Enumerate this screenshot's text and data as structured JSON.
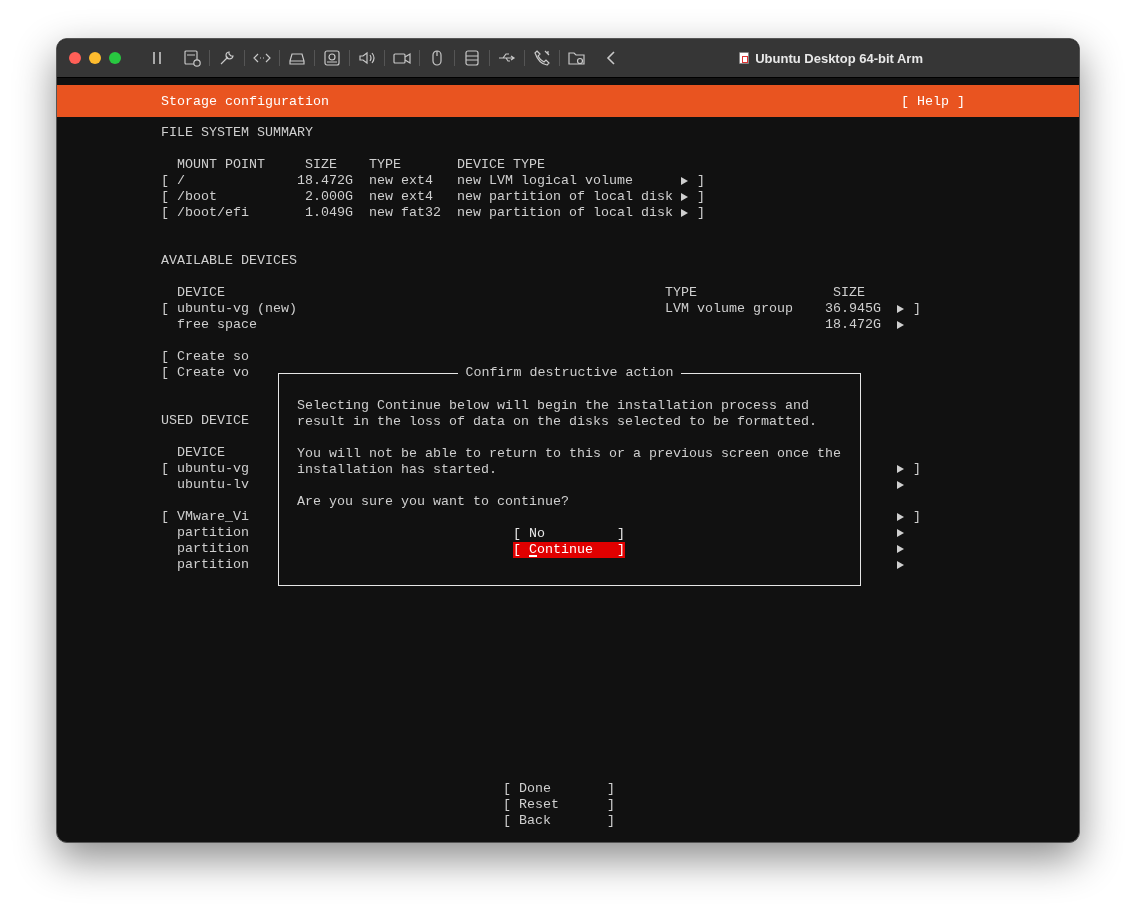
{
  "window": {
    "title": "Ubuntu Desktop 64-bit Arm"
  },
  "header": {
    "title": "Storage configuration",
    "help": "[ Help ]"
  },
  "summary": {
    "heading": "FILE SYSTEM SUMMARY",
    "columns": [
      "MOUNT POINT",
      "SIZE",
      "TYPE",
      "DEVICE TYPE"
    ],
    "rows": [
      {
        "open": "[",
        "mount": "/",
        "size": "18.472G",
        "type": "new ext4",
        "device_type": "new LVM logical volume",
        "close": "]"
      },
      {
        "open": "[",
        "mount": "/boot",
        "size": "2.000G",
        "type": "new ext4",
        "device_type": "new partition of local disk",
        "close": "]"
      },
      {
        "open": "[",
        "mount": "/boot/efi",
        "size": "1.049G",
        "type": "new fat32",
        "device_type": "new partition of local disk",
        "close": "]"
      }
    ]
  },
  "available": {
    "heading": "AVAILABLE DEVICES",
    "columns": [
      "DEVICE",
      "TYPE",
      "SIZE"
    ],
    "groups": [
      [
        {
          "kind": "device",
          "open": "[",
          "device": "ubuntu-vg (new)",
          "type": "LVM volume group",
          "size": "36.945G",
          "close": "]"
        },
        {
          "kind": "device",
          "device": "free space",
          "size": "18.472G"
        }
      ],
      [
        {
          "kind": "action",
          "open": "[",
          "device": "Create so"
        },
        {
          "kind": "action",
          "open": "[",
          "device": "Create vo"
        }
      ]
    ]
  },
  "used": {
    "heading": "USED DEVICE",
    "columns": [
      "DEVICE"
    ],
    "groups": [
      [
        {
          "kind": "device",
          "open": "[",
          "device": "ubuntu-vg",
          "close": "]"
        },
        {
          "kind": "device",
          "device": "ubuntu-lv"
        }
      ],
      [
        {
          "kind": "device",
          "open": "[",
          "device": "VMware_Vi",
          "close": "]"
        },
        {
          "kind": "device",
          "device": "partition"
        },
        {
          "kind": "device",
          "device": "partition"
        },
        {
          "kind": "device",
          "device": "partition"
        }
      ]
    ]
  },
  "dialog": {
    "title": "Confirm destructive action",
    "paragraphs": [
      "Selecting Continue below will begin the installation process and\nresult in the loss of data on the disks selected to be formatted.",
      "You will not be able to return to this or a previous screen once the\ninstallation has started.",
      "Are you sure you want to continue?"
    ],
    "buttons": [
      {
        "label": "[ No         ]",
        "selected": false
      },
      {
        "label": "[ Continue   ]",
        "selected": true
      }
    ]
  },
  "actions": [
    {
      "label": "[ Done       ]"
    },
    {
      "label": "[ Reset      ]"
    },
    {
      "label": "[ Back       ]"
    }
  ]
}
